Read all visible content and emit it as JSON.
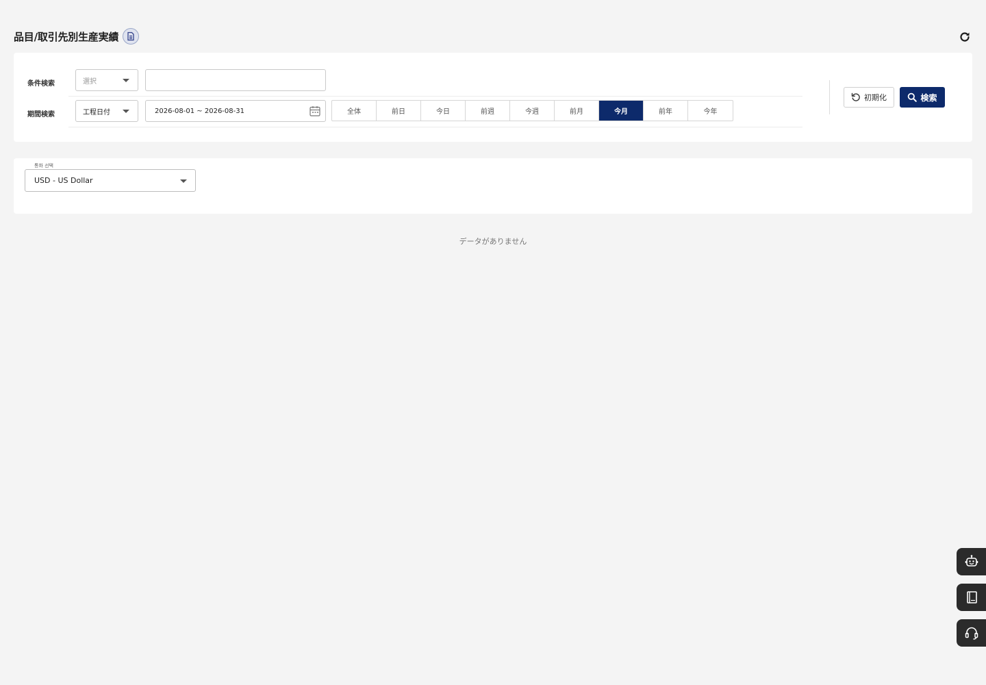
{
  "header": {
    "title": "品目/取引先別生産実績"
  },
  "search": {
    "condition_label": "条件検索",
    "condition_select_placeholder": "選択",
    "condition_input_value": "",
    "period_label": "期間検索",
    "period_select_value": "工程日付",
    "date_range": "2026-08-01 ~ 2026-08-31",
    "period_tabs": [
      {
        "label": "全体",
        "active": false
      },
      {
        "label": "前日",
        "active": false
      },
      {
        "label": "今日",
        "active": false
      },
      {
        "label": "前週",
        "active": false
      },
      {
        "label": "今週",
        "active": false
      },
      {
        "label": "前月",
        "active": false
      },
      {
        "label": "今月",
        "active": true
      },
      {
        "label": "前年",
        "active": false
      },
      {
        "label": "今年",
        "active": false
      }
    ],
    "reset_label": "初期化",
    "search_label": "検索"
  },
  "currency": {
    "label": "통화 선택",
    "value": "USD - US Dollar"
  },
  "empty_message": "データがありません",
  "colors": {
    "primary": "#0d2a6b",
    "background": "#f4f4f4",
    "fab": "#2b2b2b"
  },
  "icons": {
    "doc": "document-icon",
    "refresh": "refresh-icon",
    "calendar": "calendar-icon",
    "reset": "reset-icon",
    "search": "search-icon",
    "bot": "bot-icon",
    "book": "book-icon",
    "support": "headset-icon"
  }
}
